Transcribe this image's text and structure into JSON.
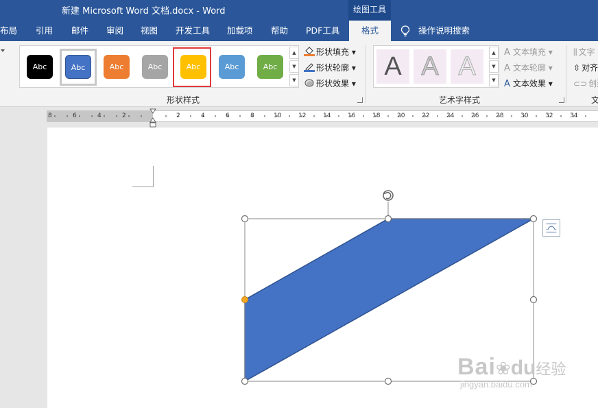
{
  "window": {
    "title": "新建 Microsoft Word 文档.docx  -  Word",
    "context_tab_group": "绘图工具"
  },
  "tabs": [
    {
      "label": "布局"
    },
    {
      "label": "引用"
    },
    {
      "label": "邮件"
    },
    {
      "label": "审阅"
    },
    {
      "label": "视图"
    },
    {
      "label": "开发工具"
    },
    {
      "label": "加载项"
    },
    {
      "label": "帮助"
    },
    {
      "label": "PDF工具"
    },
    {
      "label": "格式",
      "active": true
    },
    {
      "label": "操作说明搜索"
    }
  ],
  "ribbon": {
    "shape_styles": {
      "label": "形状样式",
      "swatches": [
        {
          "text": "Abc",
          "color": "#000000"
        },
        {
          "text": "Abc",
          "color": "#4472c4",
          "selected": true
        },
        {
          "text": "Abc",
          "color": "#ed7d31"
        },
        {
          "text": "Abc",
          "color": "#a5a5a5"
        },
        {
          "text": "Abc",
          "color": "#ffc000",
          "highlighted": true
        },
        {
          "text": "Abc",
          "color": "#5b9bd5"
        },
        {
          "text": "Abc",
          "color": "#70ad47"
        }
      ],
      "commands": {
        "fill": "形状填充",
        "outline": "形状轮廓",
        "effects": "形状效果"
      }
    },
    "wordart_styles": {
      "label": "艺术字样式",
      "samples": [
        "A",
        "A",
        "A"
      ],
      "commands": {
        "text_fill": "文本填充",
        "text_outline": "文本轮廓",
        "text_effects": "文本效果"
      }
    },
    "text_group": {
      "items": {
        "direction": "文字",
        "align": "对齐",
        "create_link": "创建"
      },
      "label": "文"
    }
  },
  "ruler": {
    "labels": [
      "8",
      "6",
      "4",
      "2",
      "2",
      "4",
      "6",
      "8",
      "10",
      "12",
      "14",
      "16",
      "18",
      "20",
      "22",
      "24",
      "26",
      "28",
      "30",
      "32",
      "34"
    ]
  },
  "shape": {
    "fill": "#4472c4",
    "outline": "#2f528f",
    "adjust_handle_color": "#f5a623"
  },
  "watermark": {
    "brand": "Bai",
    "brand2": "du",
    "brand_cn": "经验",
    "site": "jingyan.baidu.com"
  }
}
